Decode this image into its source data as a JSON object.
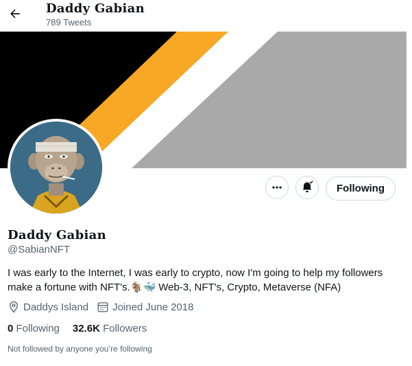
{
  "header": {
    "title": "Daddy Gabian",
    "tweet_count": "789 Tweets"
  },
  "profile": {
    "display_name": "Daddy Gabian",
    "handle": "@SabianNFT",
    "bio_line1": "I was early to the Internet, I was early to crypto, now I'm going to help my followers",
    "bio_line2_text1": "make a fortune with NFT's.",
    "bio_emoji": "🐐🐳",
    "bio_line2_text2": "Web-3, NFT's, Crypto, Metaverse (NFA)",
    "location": "Daddys Island",
    "joined": "Joined June 2018",
    "following_count": "0",
    "following_label": "Following",
    "followers_count": "32.6K",
    "followers_label": "Followers",
    "followed_by_note": "Not followed by anyone you’re following"
  },
  "actions": {
    "follow_button": "Following"
  },
  "icons": {
    "back": "arrow-left-icon",
    "more": "more-horizontal-icon",
    "notify": "bell-icon",
    "location": "location-pin-icon",
    "calendar": "calendar-icon"
  },
  "colors": {
    "banner_orange": "#f9a825",
    "banner_gray": "#a9a9a9",
    "avatar_bg": "#3b6b86"
  }
}
